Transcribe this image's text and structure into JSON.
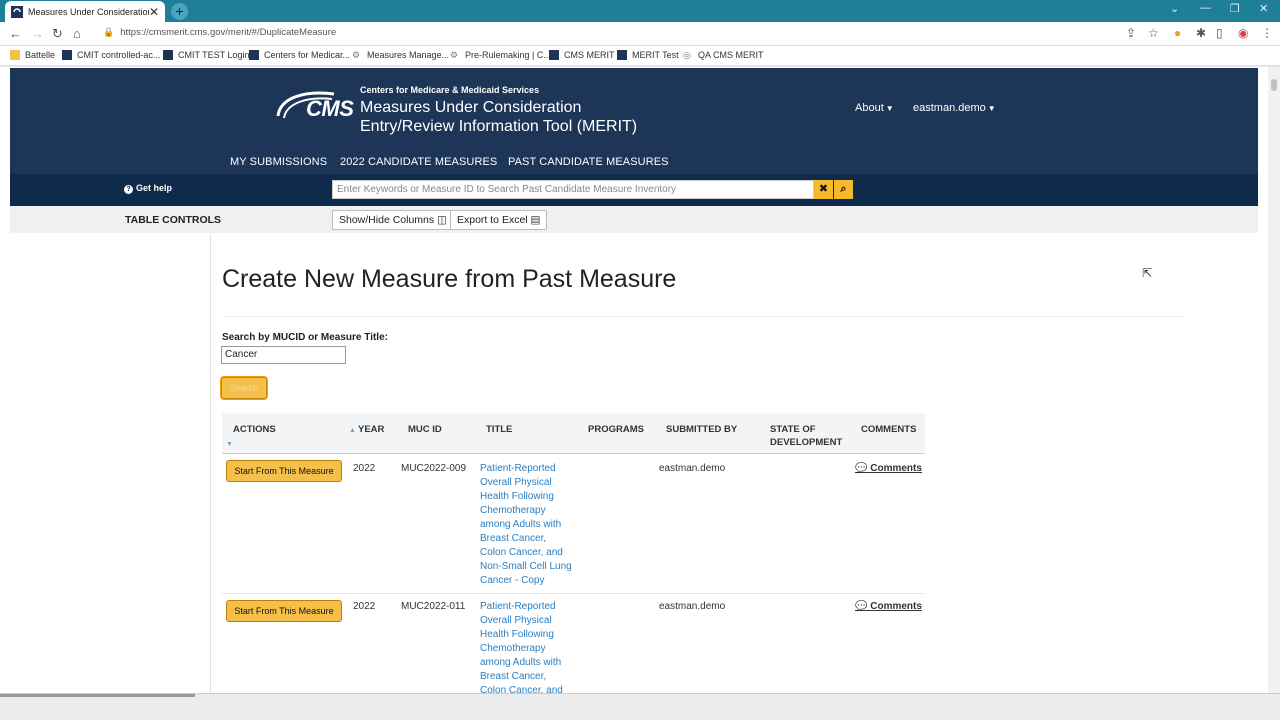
{
  "browser": {
    "tab_title": "Measures Under Consideration",
    "tab_close": "✕",
    "new_tab": "+",
    "url": "https://cmsmerit.cms.gov/merit/#/DuplicateMeasure",
    "bookmarks": [
      "Battelle",
      "CMIT controlled-ac...",
      "CMIT TEST Login",
      "Centers for Medicar...",
      "Measures Manage...",
      "Pre-Rulemaking | C...",
      "CMS MERIT",
      "MERIT Test",
      "QA CMS MERIT"
    ]
  },
  "header": {
    "logo": "CMS",
    "org": "Centers for Medicare & Medicaid Services",
    "app_title_line1": "Measures Under Consideration",
    "app_title_line2": "Entry/Review Information Tool (MERIT)",
    "about": "About",
    "user": "eastman.demo",
    "nav": [
      "MY SUBMISSIONS",
      "2022 CANDIDATE MEASURES",
      "PAST CANDIDATE MEASURES"
    ]
  },
  "searchstrip": {
    "get_help": "Get help",
    "placeholder": "Enter Keywords or Measure ID to Search Past Candidate Measure Inventory"
  },
  "controls": {
    "label": "TABLE CONTROLS",
    "show_hide": "Show/Hide Columns",
    "export": "Export to Excel"
  },
  "page": {
    "title": "Create New Measure from Past Measure",
    "search_label": "Search by MUCID or Measure Title:",
    "search_value": "Cancer",
    "search_button": "Search"
  },
  "table": {
    "headers": [
      "ACTIONS",
      "YEAR",
      "MUC ID",
      "TITLE",
      "PROGRAMS",
      "SUBMITTED BY",
      "STATE OF DEVELOPMENT",
      "COMMENTS"
    ],
    "rows": [
      {
        "action": "Start From This Measure",
        "year": "2022",
        "muc_id": "MUC2022-009",
        "title": "Patient-Reported Overall Physical Health Following Chemotherapy among Adults with Breast Cancer, Colon Cancer, and Non-Small Cell Lung Cancer - Copy",
        "programs": "",
        "submitted_by": "eastman.demo",
        "state": "",
        "comments": "Comments"
      },
      {
        "action": "Start From This Measure",
        "year": "2022",
        "muc_id": "MUC2022-011",
        "title": "Patient-Reported Overall Physical Health Following Chemotherapy among Adults with Breast Cancer, Colon Cancer, and",
        "programs": "",
        "submitted_by": "eastman.demo",
        "state": "",
        "comments": "Comments"
      }
    ]
  },
  "colors": {
    "header_bg": "#1d3557",
    "strip_bg": "#0f2b4b",
    "accent_yellow": "#f5c04a",
    "link_blue": "#2a7fc2",
    "tab_bar": "#1f7f99"
  }
}
